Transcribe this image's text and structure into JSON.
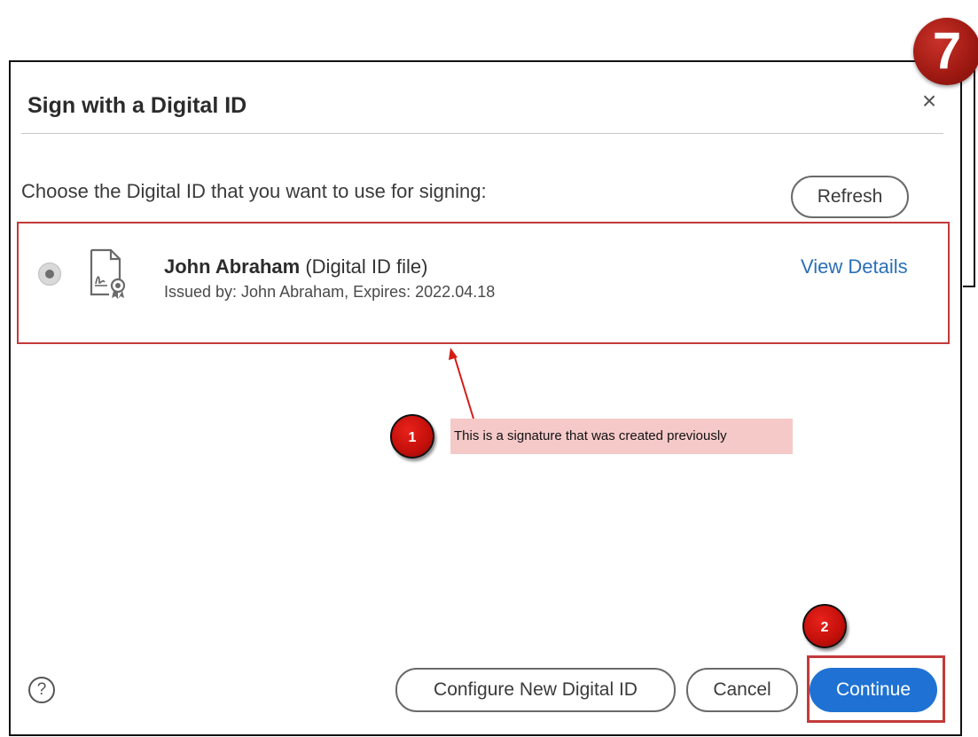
{
  "step_number": "7",
  "dialog": {
    "title": "Sign with a Digital ID",
    "close_label": "×",
    "prompt": "Choose the Digital ID that you want to use for signing:",
    "refresh_label": "Refresh"
  },
  "digital_id": {
    "name": "John Abraham",
    "type": "(Digital ID file)",
    "issued": "Issued by: John Abraham, Expires: 2022.04.18",
    "view_details_label": "View Details",
    "selected": true
  },
  "annotations": {
    "marker_1": "1",
    "note_1": "This is a signature that was created previously",
    "marker_2": "2"
  },
  "footer": {
    "help_label": "?",
    "configure_label": "Configure New Digital ID",
    "cancel_label": "Cancel",
    "continue_label": "Continue"
  },
  "colors": {
    "accent": "#1f72d3",
    "highlight": "#c33a3a",
    "note_bg": "#f6c9c9",
    "marker": "#c30f0a"
  }
}
